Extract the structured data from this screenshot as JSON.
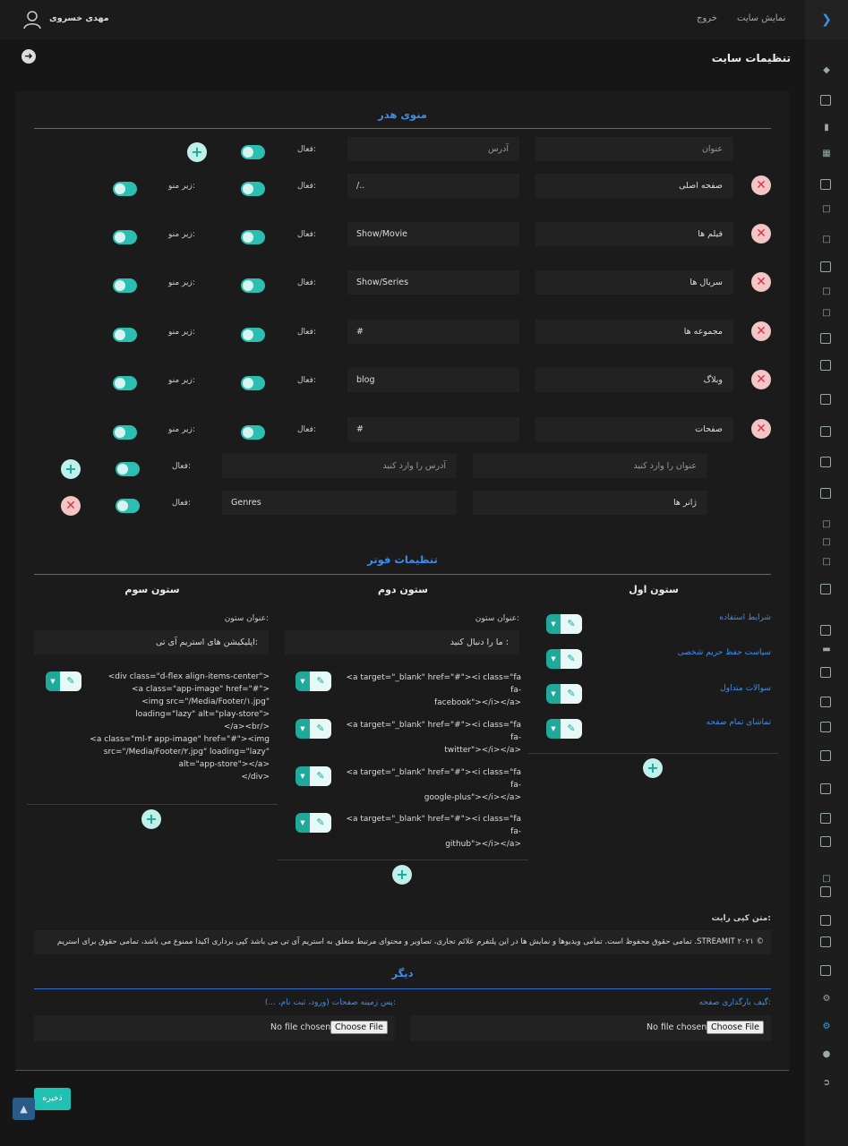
{
  "topbar": {
    "user_name": "مهدی خسروی",
    "link_show_site": "نمایش سایت",
    "link_logout": "خروج"
  },
  "page": {
    "title": "تنظیمات سایت"
  },
  "header_menu": {
    "title": "منوی هدر",
    "labels": {
      "title_col": "عنوان",
      "address_col": "آدرس",
      "active": "فعال:",
      "submenu": "زیر منو:"
    },
    "items": [
      {
        "title": "صفحه اصلی",
        "address": "/.."
      },
      {
        "title": "فیلم ها",
        "address": "Show/Movie"
      },
      {
        "title": "سریال ها",
        "address": "Show/Series"
      },
      {
        "title": "مجموعه ها",
        "address": "#"
      },
      {
        "title": "وبلاگ",
        "address": "blog"
      },
      {
        "title": "صفحات",
        "address": "#"
      }
    ],
    "new_item": {
      "title_placeholder": "عنوان را وارد کنید",
      "address_placeholder": "آدرس را وارد کنید",
      "active": "فعال:"
    },
    "sub_item": {
      "title": "ژانر ها",
      "address": "Genres",
      "active": "فعال:"
    }
  },
  "footer": {
    "title": "تنظیمات فوتر",
    "col_title_label": "عنوان ستون:",
    "col1": {
      "head": "ستون اول",
      "links": [
        "شرایط استفاده",
        "سیاست حفظ حریم شخصی",
        "سوالات متداول",
        "تماشای تمام صفحه"
      ]
    },
    "col2": {
      "head": "ستون دوم",
      "title_value": "ما را دنبال کنید :",
      "items": [
        "<a target=\"_blank\" href=\"#\"><i class=\"fa fa-\nfacebook\"></i></a>",
        "<a target=\"_blank\" href=\"#\"><i class=\"fa fa-\ntwitter\"></i></a>",
        "<a target=\"_blank\" href=\"#\"><i class=\"fa fa-\ngoogle-plus\"></i></a>",
        "<a target=\"_blank\" href=\"#\"><i class=\"fa fa-\ngithub\"></i></a>"
      ]
    },
    "col3": {
      "head": "ستون سوم",
      "title_value": "اپلیکیشن های استریم آی تی:",
      "code": "<div class=\"d-flex align-items-center\">\n<a class=\"app-image\" href=\"#\">\n<img src=\"/Media/Footer/۱.jpg\"\nloading=\"lazy\" alt=\"play-store\">\n</a><br/>\n<a class=\"ml-۳ app-image\" href=\"#\"><img\nsrc=\"/Media/Footer/۲.jpg\" loading=\"lazy\"\nalt=\"app-store\"></a>\n</div>"
    },
    "copyright_label": "متن کپی رایت:",
    "copyright_text": "© STREAMIT ۲۰۲۱. تمامی حقوق محفوظ است. تمامی ویدیوها و نمایش ها در این پلتفرم علائم تجاری، تصاویر و محتوای مرتبط متعلق به استریم آی تی می باشد کپی برداری اکیدا ممنوع می باشد، تمامی حقوق برای استریم"
  },
  "other": {
    "title": "دیگر",
    "loading_gif_label": "گیف بارگذاری صفحه:",
    "bg_label": "پس زمینه صفحات (ورود، ثبت نام، ...):",
    "choose_file": "Choose File",
    "no_file": "No file chosen"
  },
  "save_label": "ذخیره",
  "colors": {
    "accent": "#3f8ee8",
    "teal": "#1fc2b2",
    "danger": "#d9304a"
  }
}
